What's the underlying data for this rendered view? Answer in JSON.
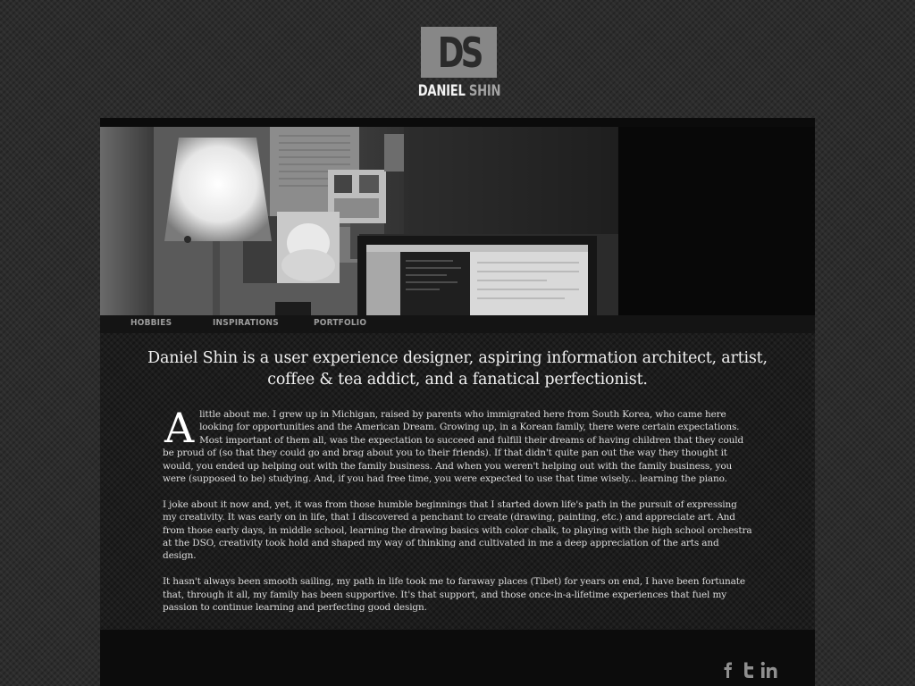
{
  "brand": {
    "monogram": "DS",
    "first_name": "DANIEL",
    "last_name": "SHIN"
  },
  "nav": {
    "items": [
      {
        "label": "HOBBIES"
      },
      {
        "label": "INSPIRATIONS"
      },
      {
        "label": "PORTFOLIO"
      }
    ]
  },
  "hero": {
    "image": "workspace-desk-photo"
  },
  "intro": {
    "tagline": "Daniel Shin is a user experience designer, aspiring information architect, artist, coffee & tea addict, and a fanatical perfectionist."
  },
  "bio": {
    "dropcap": "A",
    "p1": "little about me. I grew up in Michigan, raised by parents who immigrated here from South Korea, who came here looking for opportunities and the American Dream. Growing up, in a Korean family, there were certain expectations. Most important of them all, was the expectation to succeed and fulfill their dreams of having children that they could be proud of (so that they could go and brag about you to their friends). If that didn't quite pan out the way they thought it would, you ended up helping out with the family business. And when you weren't helping out with the family business, you were (supposed to be) studying. And, if you had free time, you were expected to use that time wisely... learning the piano.",
    "p2": "I joke about it now and, yet, it was from those humble beginnings that I started down life's path in the pursuit of expressing my creativity. It was early on in life, that I discovered a penchant to create (drawing, painting, etc.) and appreciate art. And from those early days, in middle school, learning the drawing basics with color chalk, to playing with the high school orchestra at the DSO, creativity took hold and shaped my way of thinking and cultivated in me a deep appreciation of the arts and design.",
    "p3": "It hasn't always been smooth sailing, my path in life took me to faraway places (Tibet) for years on end, I have been fortunate that, through it all, my family has been supportive. It's that support, and those once-in-a-lifetime experiences that fuel my passion to continue learning and perfecting good design."
  },
  "footer": {
    "social": [
      {
        "icon": "facebook-icon"
      },
      {
        "icon": "twitter-icon"
      },
      {
        "icon": "linkedin-icon"
      }
    ]
  },
  "colors": {
    "page_bg": "#2c2c2c",
    "container_bg": "#0b0b0b",
    "logo_box": "#878787",
    "nav_text": "#9c9c9c",
    "body_text": "#dcdcdc"
  }
}
